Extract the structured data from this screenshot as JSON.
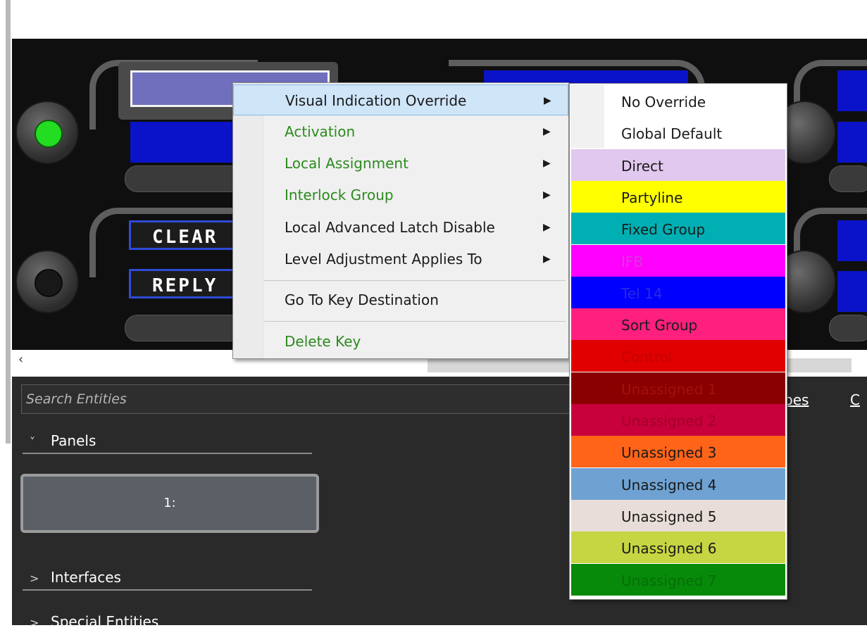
{
  "panel": {
    "keys": [
      {
        "label": "CLEAR"
      },
      {
        "label": "REPLY"
      }
    ]
  },
  "scroll": {
    "left_arrow": "‹"
  },
  "search": {
    "placeholder": "Search Entities"
  },
  "tabs": {
    "types": "pes",
    "c": "C"
  },
  "sections": {
    "panels": {
      "label": "Panels",
      "chevron": "˅"
    },
    "interfaces": {
      "label": "Interfaces",
      "chevron": ">"
    },
    "special": {
      "label": "Special Entities",
      "chevron": ">"
    }
  },
  "panel_card": {
    "label": "1:"
  },
  "context_menu": {
    "items": [
      {
        "label": "Visual Indication Override",
        "arrow": "▶"
      },
      {
        "label": "Activation",
        "arrow": "▶"
      },
      {
        "label": "Local Assignment",
        "arrow": "▶"
      },
      {
        "label": "Interlock Group",
        "arrow": "▶"
      },
      {
        "label": "Local Advanced Latch Disable",
        "arrow": "▶"
      },
      {
        "label": "Level Adjustment Applies To",
        "arrow": "▶"
      },
      {
        "label": "Go To Key Destination"
      },
      {
        "label": "Delete Key"
      }
    ]
  },
  "submenu": {
    "items": [
      {
        "label": "No Override",
        "color": "#ffffff",
        "text_color": "#1a1a1a"
      },
      {
        "label": "Global Default",
        "color": "#ffffff",
        "text_color": "#1a1a1a"
      },
      {
        "label": "Direct",
        "color": "#e1c8ef",
        "text_color": "#1a1a1a"
      },
      {
        "label": "Partyline",
        "color": "#ffff00",
        "text_color": "#1a1a1a"
      },
      {
        "label": "Fixed Group",
        "color": "#00afb3",
        "text_color": "#1a1a1a"
      },
      {
        "label": "IFB",
        "color": "#ff00ff",
        "text_color": "#d63cd6"
      },
      {
        "label": "Tel 14",
        "color": "#0000ff",
        "text_color": "#2a2ae0"
      },
      {
        "label": "Sort Group",
        "color": "#ff1f7f",
        "text_color": "#1a1a1a"
      },
      {
        "label": "Control",
        "color": "#e10000",
        "text_color": "#c40000"
      },
      {
        "label": "Unassigned 1",
        "color": "#8a0000",
        "text_color": "#a31010"
      },
      {
        "label": "Unassigned 2",
        "color": "#c8003c",
        "text_color": "#a3002a"
      },
      {
        "label": "Unassigned 3",
        "color": "#ff6419",
        "text_color": "#1a1a1a"
      },
      {
        "label": "Unassigned 4",
        "color": "#6fa2d2",
        "text_color": "#1a1a1a"
      },
      {
        "label": "Unassigned 5",
        "color": "#e8ddd8",
        "text_color": "#1a1a1a"
      },
      {
        "label": "Unassigned 6",
        "color": "#c6d642",
        "text_color": "#1a1a1a"
      },
      {
        "label": "Unassigned 7",
        "color": "#078a0a",
        "text_color": "#066e08"
      }
    ]
  },
  "colors": {
    "knob_led_active": "#22dd22",
    "lcd_blue": "#0b13c8",
    "menu_highlight": "#cfe5f8",
    "menu_green_text": "#2c8a1e"
  }
}
